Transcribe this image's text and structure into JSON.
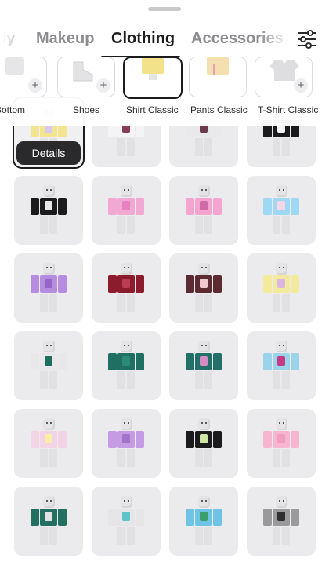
{
  "tabs": [
    {
      "label": "dy",
      "active": false
    },
    {
      "label": "Makeup",
      "active": false
    },
    {
      "label": "Clothing",
      "active": true
    },
    {
      "label": "Accessories",
      "active": false
    }
  ],
  "filter_icon": "sliders-icon",
  "subcategories": [
    {
      "label": "Bottom",
      "icon": "bottom-icon",
      "selected": false
    },
    {
      "label": "Shoes",
      "icon": "shoe-icon",
      "selected": false
    },
    {
      "label": "Shirt Classic",
      "icon": "shirt-classic-icon",
      "selected": true
    },
    {
      "label": "Pants Classic",
      "icon": "pants-classic-icon",
      "selected": false
    },
    {
      "label": "T-Shirt Classic",
      "icon": "tshirt-classic-icon",
      "selected": false
    }
  ],
  "details_label": "Details",
  "items": [
    {
      "shirt": "#f3e58f",
      "accent": "#d8c9f0",
      "selected": true
    },
    {
      "shirt": "#f4f4f6",
      "accent": "#8a3b57"
    },
    {
      "shirt": "#e9e9ec",
      "accent": "#6b3b4b"
    },
    {
      "shirt": "#1b1b1d",
      "accent": "#f4f4f6"
    },
    {
      "shirt": "#1b1b1d",
      "accent": "#e7e7ea"
    },
    {
      "shirt": "#f1a9d3",
      "accent": "#e980bf"
    },
    {
      "shirt": "#f4a4cf",
      "accent": "#d06aa7"
    },
    {
      "shirt": "#9fd8f2",
      "accent": "#f6d6e6"
    },
    {
      "shirt": "#b68ce0",
      "accent": "#9467c5"
    },
    {
      "shirt": "#8b1b2d",
      "accent": "#ba3d55"
    },
    {
      "shirt": "#5c2b32",
      "accent": "#f0c8cf"
    },
    {
      "shirt": "#f3ea9d",
      "accent": "#d9b6e3"
    },
    {
      "shirt": "#e8e8ea",
      "accent": "#1f6f60"
    },
    {
      "shirt": "#1f6f62",
      "accent": "#2d8a79"
    },
    {
      "shirt": "#23706a",
      "accent": "#d58cc2"
    },
    {
      "shirt": "#9bd4ea",
      "accent": "#c43a86"
    },
    {
      "shirt": "#f3d4e6",
      "accent": "#f7eeaa"
    },
    {
      "shirt": "#c59be3",
      "accent": "#a373c9"
    },
    {
      "shirt": "#1b1b1d",
      "accent": "#d2e6a3"
    },
    {
      "shirt": "#f6b6d1",
      "accent": "#f19dc0"
    },
    {
      "shirt": "#22705f",
      "accent": "#e2e2e4"
    },
    {
      "shirt": "#e6e6e8",
      "accent": "#5ec4c8"
    },
    {
      "shirt": "#6fc4e6",
      "accent": "#3aa06a"
    },
    {
      "shirt": "#9a9a9c",
      "accent": "#2e2e30"
    }
  ]
}
